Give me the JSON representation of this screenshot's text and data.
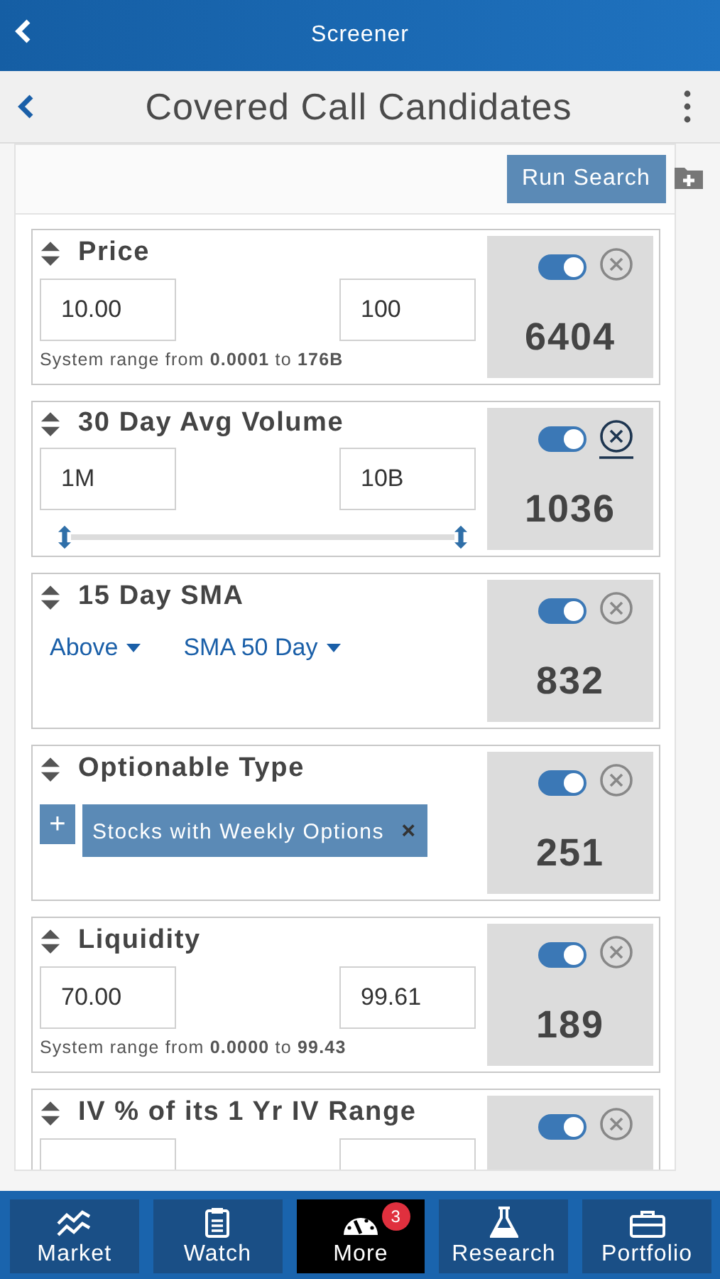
{
  "header": {
    "title": "Screener"
  },
  "toolbar": {
    "title": "Covered Call Candidates"
  },
  "run_search": "Run Search",
  "criteria": [
    {
      "kind": "range",
      "name": "Price",
      "min": "10.00",
      "max": "100",
      "range_note": "System range from **0.0001** to **176B**",
      "on": true,
      "focused": false,
      "count": "6404"
    },
    {
      "kind": "range",
      "name": "30 Day Avg Volume",
      "min": "1M",
      "max": "10B",
      "slider": {
        "level": 1
      },
      "on": true,
      "focused": true,
      "count": "1036"
    },
    {
      "kind": "compare",
      "name": "15 Day SMA",
      "options": [
        "Above",
        "SMA 50 Day"
      ],
      "on": true,
      "focused": false,
      "count": "832"
    },
    {
      "kind": "tags",
      "name": "Optionable Type",
      "add": "+",
      "tags": [
        {
          "label": "Stocks with Weekly Options",
          "remove": "×"
        }
      ],
      "on": true,
      "focused": false,
      "count": "251"
    },
    {
      "kind": "range",
      "name": "Liquidity",
      "min": "70.00",
      "max": "99.61",
      "range_note": "System range from **0.0000** to **99.43**",
      "on": true,
      "focused": false,
      "count": "189"
    },
    {
      "kind": "range",
      "name": "IV % of its 1 Yr IV Range",
      "on": true,
      "focused": false
    }
  ],
  "nav": [
    {
      "label": "Market",
      "selected": false
    },
    {
      "label": "Watch",
      "selected": false
    },
    {
      "label": "More",
      "selected": true,
      "badge": "3"
    },
    {
      "label": "Research",
      "selected": false
    },
    {
      "label": "Portfolio",
      "selected": false
    }
  ]
}
